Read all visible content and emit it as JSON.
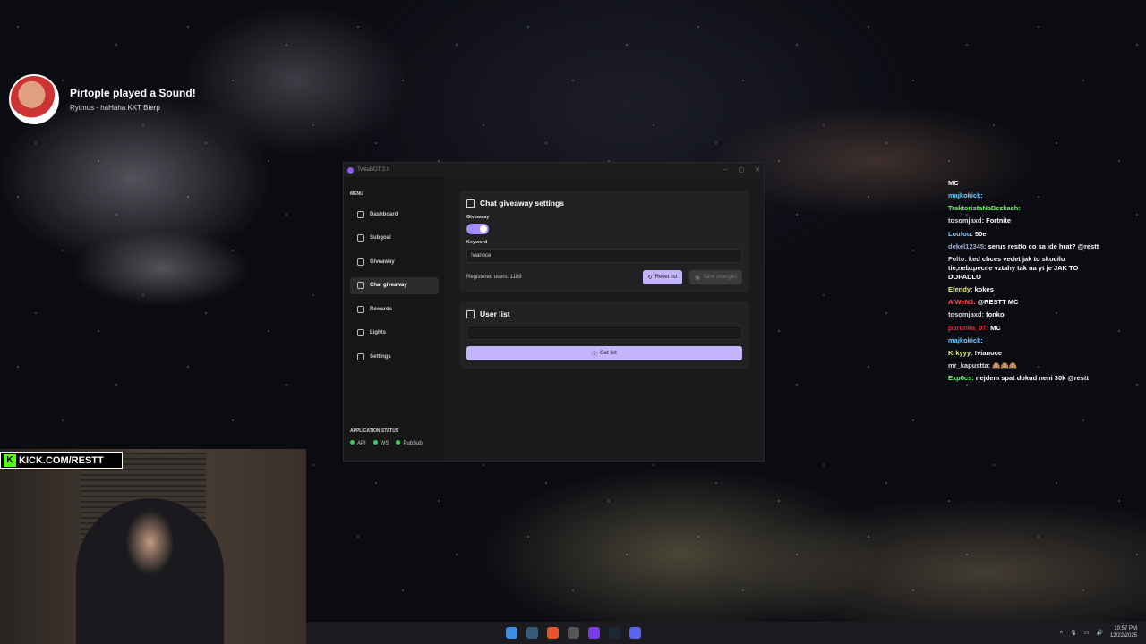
{
  "notification": {
    "title": "Pirtople played a Sound!",
    "subtitle": "Rytmus - haHaha KKT Bierp"
  },
  "window": {
    "title": "TwitaBOT 2.0",
    "min_icon": "minimize-icon",
    "max_icon": "maximize-icon",
    "close_icon": "close-icon"
  },
  "sidebar": {
    "menu_label": "MENU",
    "items": [
      {
        "label": "Dashboard",
        "icon": "home-icon"
      },
      {
        "label": "Subgoal",
        "icon": "refresh-icon"
      },
      {
        "label": "Giveaway",
        "icon": "gift-icon"
      },
      {
        "label": "Chat giveaway",
        "icon": "gift-icon"
      },
      {
        "label": "Rewards",
        "icon": "triangle-icon"
      },
      {
        "label": "Lights",
        "icon": "bulb-icon"
      },
      {
        "label": "Settings",
        "icon": "wrench-icon"
      }
    ],
    "status_label": "APPLICATION STATUS",
    "status": [
      "API",
      "WS",
      "PubSub"
    ]
  },
  "settings_card": {
    "title": "Chat giveaway settings",
    "giveaway_label": "Giveaway",
    "giveaway_enabled": true,
    "keyword_label": "Keyword",
    "keyword_value": "!vianoce",
    "registered": "Registered users: 1189",
    "reset_label": "Reset list",
    "save_label": "Save changes"
  },
  "userlist_card": {
    "title": "User list",
    "input_value": "",
    "get_label": "Get list"
  },
  "chat": [
    {
      "user": "",
      "text": "MC",
      "color": "#e23"
    },
    {
      "user": "majkokick:",
      "text": "",
      "color": "#6cf"
    },
    {
      "user": "TraktoristaNaBezkach:",
      "text": "",
      "color": "#6f6"
    },
    {
      "user": "tosomjaxd:",
      "text": "Fortnite",
      "color": "#ddd"
    },
    {
      "user": "Loufou:",
      "text": "50e",
      "color": "#8cf"
    },
    {
      "user": "dekel12345:",
      "text": "serus restto co sa ide hrat? @restt",
      "color": "#aac"
    },
    {
      "user": "Folto:",
      "text": "ked chces vedet jak to skocilo tie,nebzpecne vztahy tak na yt je JAK TO DOPADLO",
      "color": "#ccc"
    },
    {
      "user": "Efendy:",
      "text": "kokes",
      "color": "#ee8"
    },
    {
      "user": "AlWeN3:",
      "text": "@RESTT MC",
      "color": "#f55"
    },
    {
      "user": "tosomjaxd:",
      "text": "fonko",
      "color": "#ddd"
    },
    {
      "user": "Barunka_07:",
      "text": "MC",
      "color": "#e23"
    },
    {
      "user": "majkokick:",
      "text": "",
      "color": "#6cf"
    },
    {
      "user": "Krkyyy:",
      "text": "!vianoce",
      "color": "#ee8"
    },
    {
      "user": "mr_kapustta:",
      "text": "🙈🙈🙈",
      "color": "#ddd"
    },
    {
      "user": "Exp0cs:",
      "text": "nejdem spat dokud neni 30k @restt",
      "color": "#6f6"
    }
  ],
  "overlay": {
    "kick_text": "KICK.COM/RESTT"
  },
  "taskbar": {
    "time": "10:57 PM",
    "date": "12/22/2025"
  }
}
